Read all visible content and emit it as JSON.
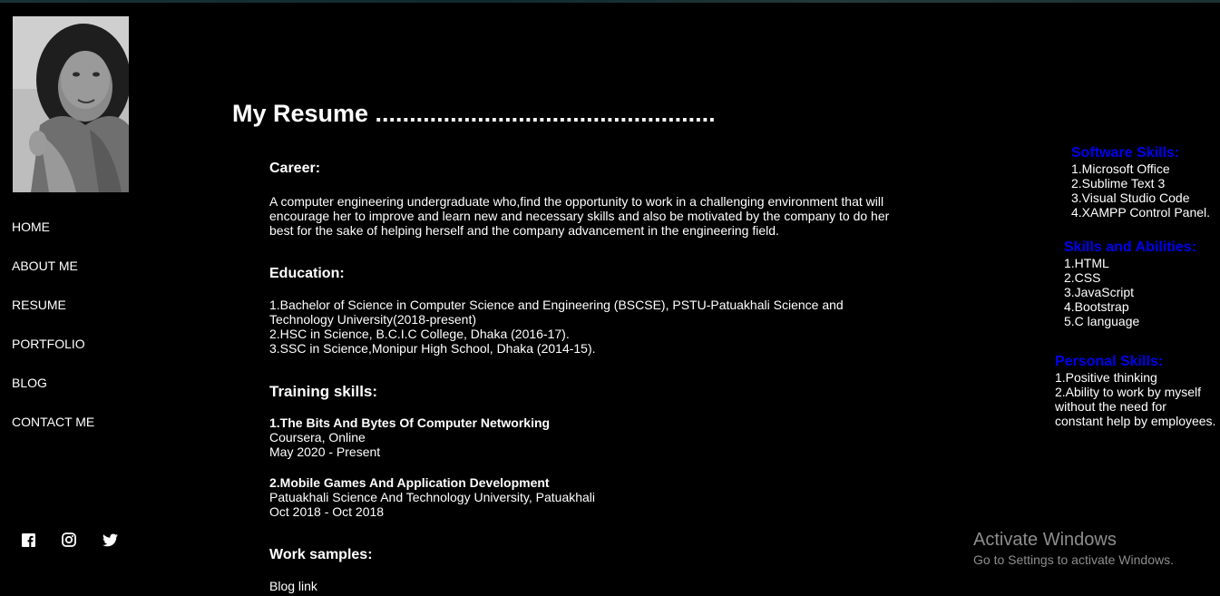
{
  "nav": [
    "HOME",
    "ABOUT ME",
    "RESUME",
    "PORTFOLIO",
    "BLOG",
    "CONTACT ME"
  ],
  "title": "My Resume ..................................................",
  "career": {
    "heading": "Career:",
    "text": "A computer engineering undergraduate who,find the opportunity to work in a challenging environment that will encourage her to improve and learn new and necessary skills and also be motivated by the company to do her best for the sake of helping herself and the company advancement in the engineering field."
  },
  "education": {
    "heading": "Education:",
    "items": [
      "1.Bachelor of Science in Computer Science and Engineering (BSCSE), PSTU-Patuakhali Science and Technology University(2018-present)",
      "2.HSC in Science, B.C.I.C College, Dhaka (2016-17).",
      "3.SSC in Science,Monipur High School, Dhaka (2014-15)."
    ]
  },
  "training": {
    "heading": "Training skills:",
    "items": [
      {
        "title": "1.The Bits And Bytes Of Computer Networking",
        "org": "Coursera, Online",
        "dates": "May 2020 - Present"
      },
      {
        "title": "2.Mobile Games And Application Development",
        "org": "Patuakhali Science And Technology University, Patuakhali",
        "dates": "Oct 2018 - Oct 2018"
      }
    ]
  },
  "work": {
    "heading": "Work samples:",
    "items": [
      "Blog link"
    ]
  },
  "software_skills": {
    "heading": "Software Skills:",
    "items": [
      "1.Microsoft Office",
      "2.Sublime Text 3",
      "3.Visual Studio Code",
      "4.XAMPP Control Panel."
    ]
  },
  "abilities": {
    "heading": "Skills and Abilities:",
    "items": [
      "1.HTML",
      "2.CSS",
      "3.JavaScript",
      "4.Bootstrap",
      "5.C language"
    ]
  },
  "personal": {
    "heading": "Personal Skills:",
    "items": [
      "1.Positive thinking",
      "2.Ability to work by myself",
      "without the need for",
      "constant help by employees."
    ]
  },
  "social": [
    "facebook-icon",
    "instagram-icon",
    "twitter-icon"
  ],
  "watermark": {
    "title": "Activate Windows",
    "subtitle": "Go to Settings to activate Windows."
  },
  "colors": {
    "background": "#000000",
    "heading_blue": "#0000ee",
    "text": "#ffffff",
    "watermark": "#8d8d8d"
  }
}
